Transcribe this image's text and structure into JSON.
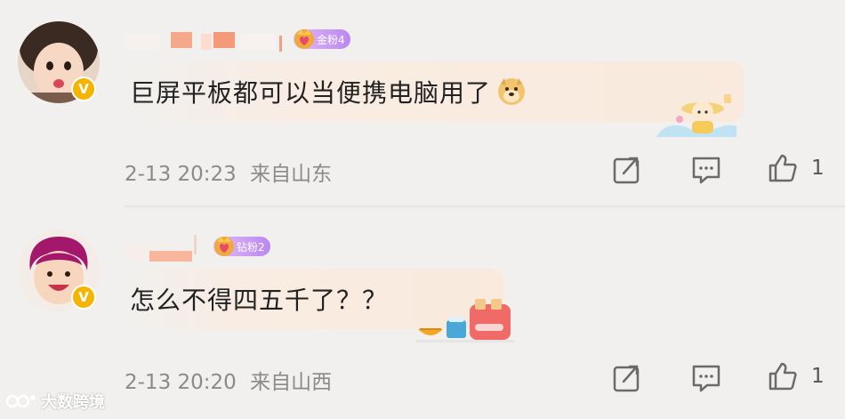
{
  "comments": [
    {
      "fan_badge": "金粉4",
      "text": "巨屏平板都可以当便携电脑用了",
      "time": "2-13 20:23",
      "location": "来自山东",
      "like_count": "1",
      "verified_mark": "V"
    },
    {
      "fan_badge": "钻粉2",
      "text": "怎么不得四五千了？？",
      "time": "2-13 20:20",
      "location": "来自山西",
      "like_count": "1",
      "verified_mark": "V"
    }
  ],
  "watermark": "大数跨境",
  "icons": {
    "share": "share-icon",
    "reply": "comment-icon",
    "like": "thumbs-up-icon",
    "emoji_1": "doge-emoji-icon",
    "emoji_2": "toaster-emoji-icon"
  },
  "colors": {
    "background": "#f1f0ee",
    "meta_text": "#8a8a8a",
    "verified": "#f5b400",
    "fan_badge": "#b988f2"
  }
}
